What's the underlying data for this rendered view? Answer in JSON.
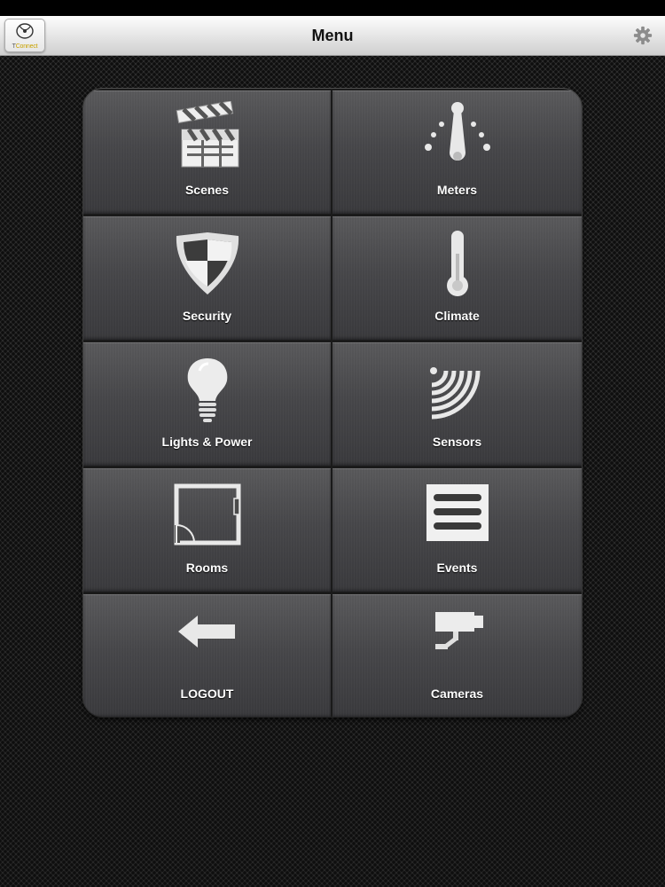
{
  "navbar": {
    "title": "Menu",
    "logo_text_prefix": "T",
    "logo_text_suffix": "Connect"
  },
  "menu": {
    "scenes": "Scenes",
    "meters": "Meters",
    "security": "Security",
    "climate": "Climate",
    "lights": "Lights & Power",
    "sensors": "Sensors",
    "rooms": "Rooms",
    "events": "Events",
    "logout": "LOGOUT",
    "cameras": "Cameras"
  },
  "icons": {
    "settings": "gear-icon",
    "scenes": "clapperboard-icon",
    "meters": "gauge-icon",
    "security": "shield-icon",
    "climate": "thermometer-icon",
    "lights": "lightbulb-icon",
    "sensors": "signal-waves-icon",
    "rooms": "floorplan-icon",
    "events": "list-icon",
    "logout": "arrow-left-icon",
    "cameras": "camera-icon"
  },
  "colors": {
    "icon": "#e8e8e8",
    "label": "#ffffff",
    "navbar": "#e4e4e4"
  }
}
